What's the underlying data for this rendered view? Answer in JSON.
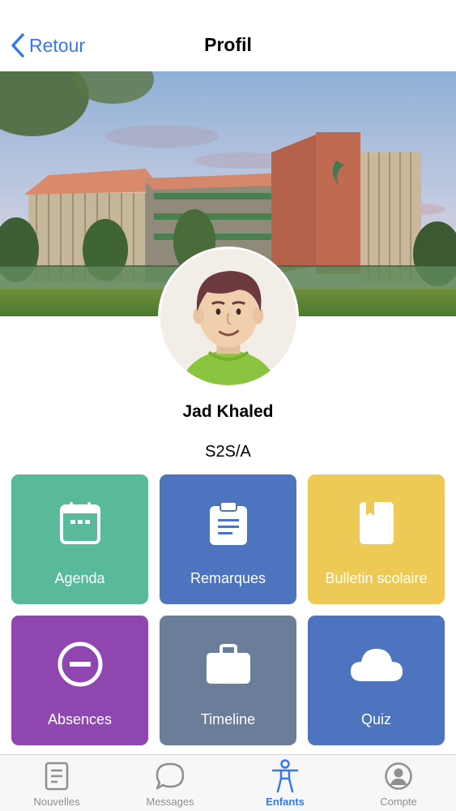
{
  "header": {
    "back_label": "Retour",
    "title": "Profil"
  },
  "profile": {
    "name": "Jad Khaled",
    "class": "S2S/A"
  },
  "tiles": [
    {
      "label": "Agenda",
      "icon": "calendar-icon",
      "color": "#58b99b"
    },
    {
      "label": "Remarques",
      "icon": "clipboard-icon",
      "color": "#4f74bf"
    },
    {
      "label": "Bulletin scolaire",
      "icon": "book-icon",
      "color": "#ecca55"
    },
    {
      "label": "Absences",
      "icon": "minus-circle-icon",
      "color": "#9046b0"
    },
    {
      "label": "Timeline",
      "icon": "briefcase-icon",
      "color": "#6a7e99"
    },
    {
      "label": "Quiz",
      "icon": "cloud-icon",
      "color": "#4f74bf"
    }
  ],
  "tabbar": {
    "items": [
      {
        "label": "Nouvelles",
        "icon": "document-icon",
        "active": false
      },
      {
        "label": "Messages",
        "icon": "chat-bubble-icon",
        "active": false
      },
      {
        "label": "Enfants",
        "icon": "person-icon",
        "active": true
      },
      {
        "label": "Compte",
        "icon": "account-circle-icon",
        "active": false
      }
    ],
    "active_color": "#3478f6",
    "inactive_color": "#8e8e93"
  }
}
